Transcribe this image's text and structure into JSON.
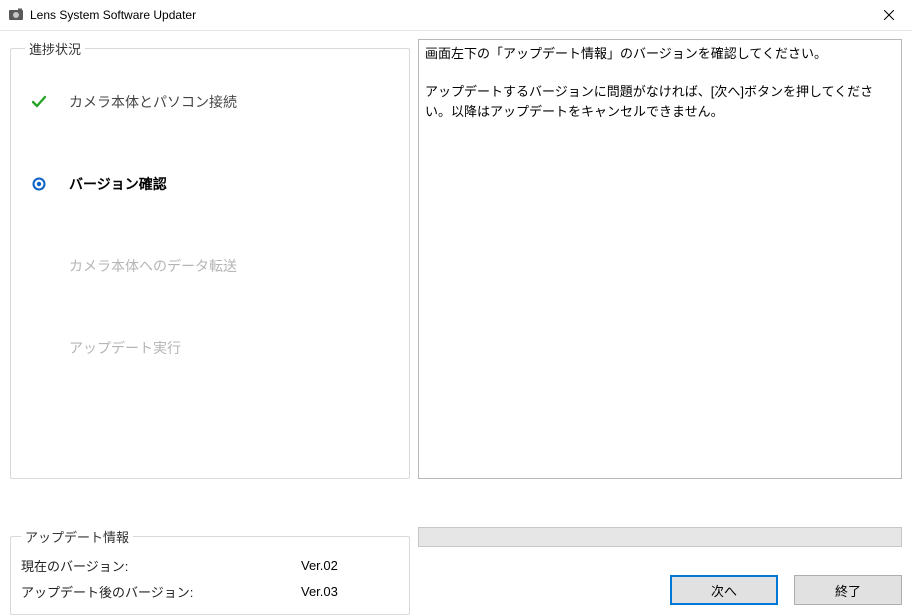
{
  "titlebar": {
    "title": "Lens System Software Updater"
  },
  "progress": {
    "legend": "進捗状況",
    "steps": [
      {
        "icon": "check",
        "label": "カメラ本体とパソコン接続",
        "state": "done"
      },
      {
        "icon": "current",
        "label": "バージョン確認",
        "state": "current"
      },
      {
        "icon": "",
        "label": "カメラ本体へのデータ転送",
        "state": "pending"
      },
      {
        "icon": "",
        "label": "アップデート実行",
        "state": "pending"
      }
    ]
  },
  "instructions": {
    "line1": "画面左下の「アップデート情報」のバージョンを確認してください。",
    "line2": "アップデートするバージョンに問題がなければ、[次へ]ボタンを押してください。以降はアップデートをキャンセルできません。"
  },
  "updateInfo": {
    "legend": "アップデート情報",
    "currentLabel": "現在のバージョン:",
    "currentValue": "Ver.02",
    "afterLabel": "アップデート後のバージョン:",
    "afterValue": "Ver.03"
  },
  "buttons": {
    "next": "次へ",
    "finish": "終了"
  },
  "colors": {
    "check": "#28a428",
    "current": "#0a63c4"
  }
}
